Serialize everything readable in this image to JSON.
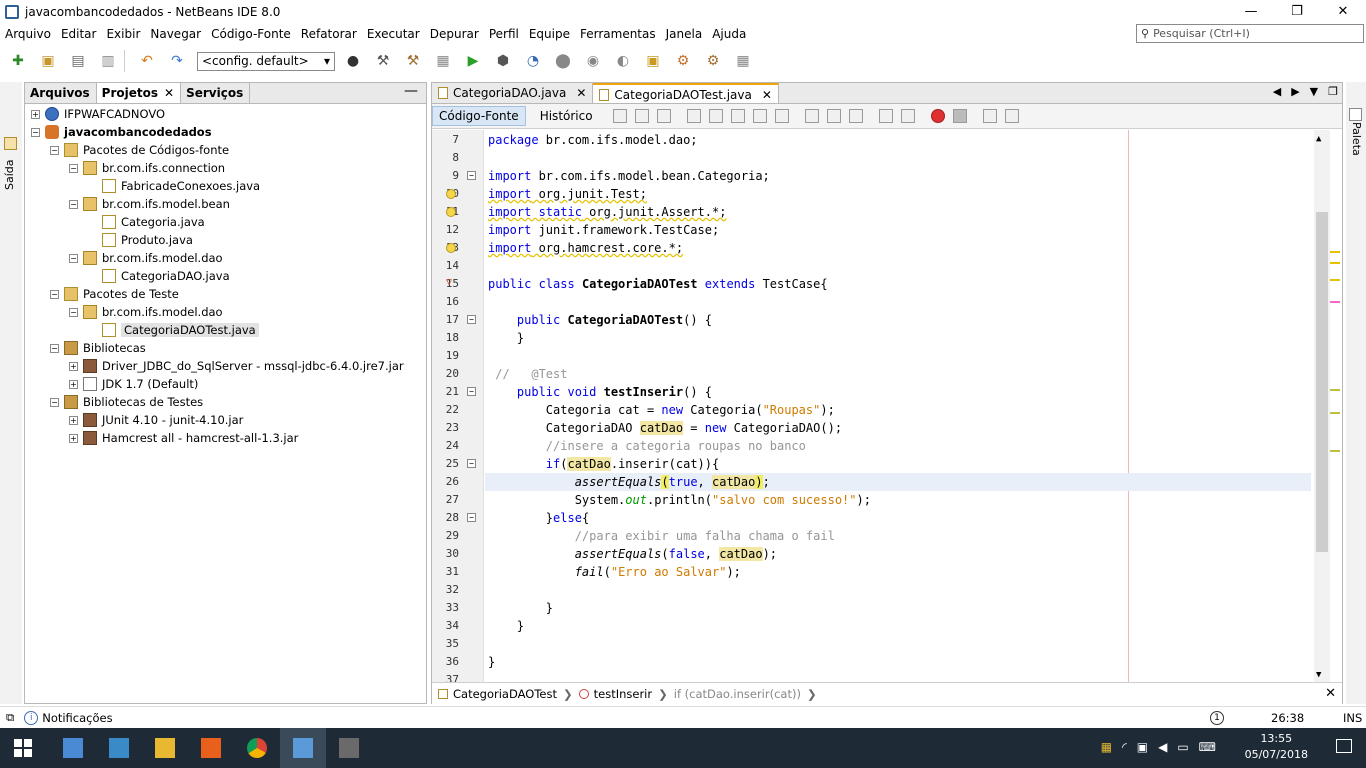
{
  "window": {
    "title": "javacombancodedados - NetBeans IDE 8.0",
    "minimize": "—",
    "maximize": "❐",
    "close": "✕"
  },
  "menu": [
    "Arquivo",
    "Editar",
    "Exibir",
    "Navegar",
    "Código-Fonte",
    "Refatorar",
    "Executar",
    "Depurar",
    "Perfil",
    "Equipe",
    "Ferramentas",
    "Janela",
    "Ajuda"
  ],
  "search": {
    "placeholder": "Pesquisar (Ctrl+I)",
    "icon": "search-icon"
  },
  "toolbar": {
    "config_value": "<config. default>",
    "config_arrow": "▾"
  },
  "left_strip": {
    "label": "Saída"
  },
  "right_strip": {
    "label": "Paleta"
  },
  "project_panel": {
    "tabs": [
      {
        "label": "Arquivos"
      },
      {
        "label": "Projetos",
        "close": "✕"
      },
      {
        "label": "Serviços"
      }
    ],
    "minimize": "—",
    "tree": [
      {
        "label": "IFPWAFCADNOVO",
        "icon": "globe-icon",
        "depth": 0,
        "expander": "+"
      },
      {
        "label": "javacombancodedados",
        "icon": "project-icon",
        "depth": 0,
        "expander": "−",
        "bold": true
      },
      {
        "label": "Pacotes de Códigos-fonte",
        "icon": "package-folder-icon",
        "depth": 1,
        "expander": "−"
      },
      {
        "label": "br.com.ifs.connection",
        "icon": "package-icon",
        "depth": 2,
        "expander": "−"
      },
      {
        "label": "FabricadeConexoes.java",
        "icon": "java-file-icon",
        "depth": 3,
        "expander": ""
      },
      {
        "label": "br.com.ifs.model.bean",
        "icon": "package-icon",
        "depth": 2,
        "expander": "−"
      },
      {
        "label": "Categoria.java",
        "icon": "java-file-icon",
        "depth": 3,
        "expander": ""
      },
      {
        "label": "Produto.java",
        "icon": "java-file-icon",
        "depth": 3,
        "expander": ""
      },
      {
        "label": "br.com.ifs.model.dao",
        "icon": "package-icon",
        "depth": 2,
        "expander": "−"
      },
      {
        "label": "CategoriaDAO.java",
        "icon": "java-file-icon",
        "depth": 3,
        "expander": ""
      },
      {
        "label": "Pacotes de Teste",
        "icon": "package-folder-icon",
        "depth": 1,
        "expander": "−"
      },
      {
        "label": "br.com.ifs.model.dao",
        "icon": "package-icon",
        "depth": 2,
        "expander": "−"
      },
      {
        "label": "CategoriaDAOTest.java",
        "icon": "java-file-icon",
        "depth": 3,
        "expander": "",
        "selected": true
      },
      {
        "label": "Bibliotecas",
        "icon": "library-icon",
        "depth": 1,
        "expander": "−"
      },
      {
        "label": "Driver_JDBC_do_SqlServer - mssql-jdbc-6.4.0.jre7.jar",
        "icon": "jar-icon",
        "depth": 2,
        "expander": "+"
      },
      {
        "label": "JDK 1.7 (Default)",
        "icon": "jdk-icon",
        "depth": 2,
        "expander": "+"
      },
      {
        "label": "Bibliotecas de Testes",
        "icon": "library-icon",
        "depth": 1,
        "expander": "−"
      },
      {
        "label": "JUnit 4.10 - junit-4.10.jar",
        "icon": "jar-icon",
        "depth": 2,
        "expander": "+"
      },
      {
        "label": "Hamcrest all - hamcrest-all-1.3.jar",
        "icon": "jar-icon",
        "depth": 2,
        "expander": "+"
      }
    ]
  },
  "editor": {
    "tabs": [
      {
        "label": "CategoriaDAO.java",
        "close": "✕"
      },
      {
        "label": "CategoriaDAOTest.java",
        "close": "✕",
        "active": true
      }
    ],
    "tab_controls": [
      "◀",
      "▶",
      "▼",
      "❐"
    ],
    "view_tabs": [
      {
        "label": "Código-Fonte",
        "active": true
      },
      {
        "label": "Histórico"
      }
    ],
    "lines": [
      {
        "n": "7",
        "html": "<span class=\"kw\">package</span> br.com.ifs.model.dao;"
      },
      {
        "n": "8",
        "html": ""
      },
      {
        "n": "9",
        "html": "<span class=\"kw\">import</span> br.com.ifs.model.bean.Categoria;",
        "fold": "−"
      },
      {
        "n": "10",
        "html": "<span class=\"wu\"><span class=\"kw\">import</span> org.junit.Test;</span>",
        "bulb": true
      },
      {
        "n": "11",
        "html": "<span class=\"wu\"><span class=\"kw\">import static</span> org.junit.Assert.*;</span>",
        "bulb": true
      },
      {
        "n": "12",
        "html": "<span class=\"kw\">import</span> junit.framework.TestCase;"
      },
      {
        "n": "13",
        "html": "<span class=\"wu\"><span class=\"kw\">import</span> org.hamcrest.core.*;</span>",
        "bulb": true
      },
      {
        "n": "14",
        "html": ""
      },
      {
        "n": "15",
        "html": "<span class=\"kw\">public class</span> <b>CategoriaDAOTest</b> <span class=\"kw\">extends</span> TestCase{",
        "warn": "▽"
      },
      {
        "n": "16",
        "html": ""
      },
      {
        "n": "17",
        "html": "    <span class=\"kw\">public</span> <b>CategoriaDAOTest</b>() {",
        "fold": "−"
      },
      {
        "n": "18",
        "html": "    }"
      },
      {
        "n": "19",
        "html": ""
      },
      {
        "n": "20",
        "html": " <span class=\"cmt\">//   @Test</span>"
      },
      {
        "n": "21",
        "html": "    <span class=\"kw\">public void</span> <b>testInserir</b>() {",
        "fold": "−"
      },
      {
        "n": "22",
        "html": "        Categoria cat = <span class=\"kw\">new</span> Categoria(<span class=\"str\">\"Roupas\"</span>);"
      },
      {
        "n": "23",
        "html": "        CategoriaDAO <span class=\"hl\">catDao</span> = <span class=\"kw\">new</span> CategoriaDAO();"
      },
      {
        "n": "24",
        "html": "        <span class=\"cmt\">//insere a categoria roupas no banco</span>"
      },
      {
        "n": "25",
        "html": "        <span class=\"kw\">if</span>(<span class=\"hl\">catDao</span>.inserir(cat)){",
        "fold": "−"
      },
      {
        "n": "26",
        "html": "            <span class=\"it\">assertEquals</span><span class=\"hlb\">(</span><span class=\"kw\">true</span>, <span class=\"hl\">catDao</span><span class=\"hlb\">)</span>;",
        "current": true
      },
      {
        "n": "27",
        "html": "            System.<span class=\"fld\">out</span>.println(<span class=\"str\">\"salvo com sucesso!\"</span>);"
      },
      {
        "n": "28",
        "html": "        }<span class=\"kw\">else</span>{",
        "fold": "−"
      },
      {
        "n": "29",
        "html": "            <span class=\"cmt\">//para exibir uma falha chama o fail</span>"
      },
      {
        "n": "30",
        "html": "            <span class=\"it\">assertEquals</span>(<span class=\"kw\">false</span>, <span class=\"hl\">catDao</span>);"
      },
      {
        "n": "31",
        "html": "            <span class=\"it\">fail</span>(<span class=\"str\">\"Erro ao Salvar\"</span>);"
      },
      {
        "n": "32",
        "html": ""
      },
      {
        "n": "33",
        "html": "        }"
      },
      {
        "n": "34",
        "html": "    }"
      },
      {
        "n": "35",
        "html": ""
      },
      {
        "n": "36",
        "html": "}"
      },
      {
        "n": "37",
        "html": ""
      }
    ],
    "breadcrumb": {
      "class": "CategoriaDAOTest",
      "method": "testInserir",
      "statement": "if (catDao.inserir(cat))",
      "close": "✕"
    },
    "error_marks": [
      {
        "pos": 0.22,
        "color": "#e6c100"
      },
      {
        "pos": 0.24,
        "color": "#e6c100"
      },
      {
        "pos": 0.27,
        "color": "#e6c100"
      },
      {
        "pos": 0.31,
        "color": "#ff66cc"
      },
      {
        "pos": 0.47,
        "color": "#c0c040"
      },
      {
        "pos": 0.51,
        "color": "#c0c040"
      },
      {
        "pos": 0.58,
        "color": "#c0c040"
      }
    ]
  },
  "statusbar": {
    "notifications": "Notificações",
    "position": "26:38",
    "mode": "INS",
    "info": "1"
  },
  "taskbar": {
    "time": "13:55",
    "date": "05/07/2018"
  }
}
